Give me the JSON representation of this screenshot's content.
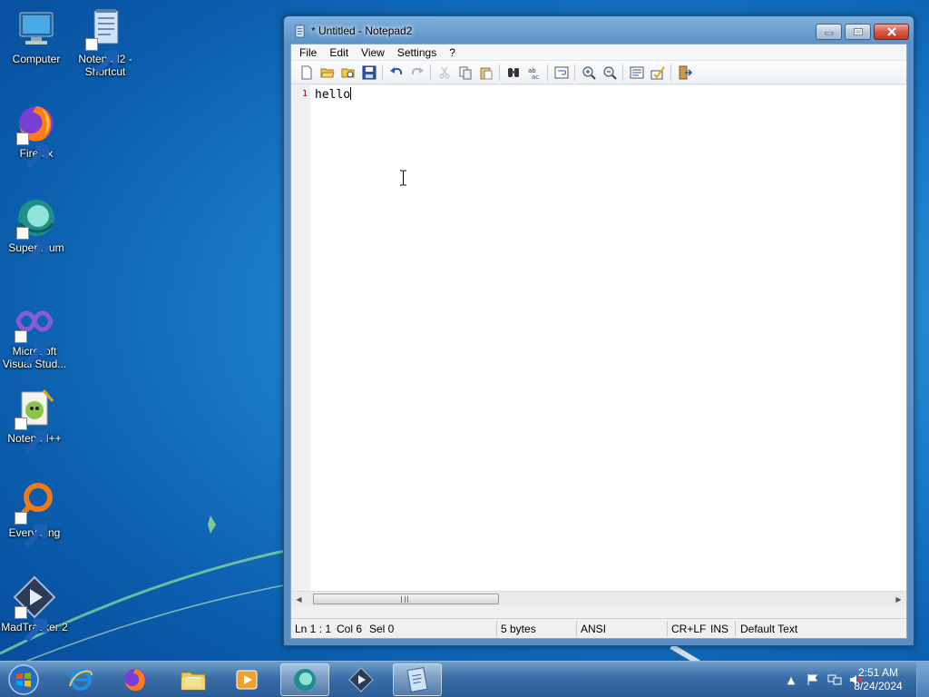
{
  "desktop": {
    "icons": [
      {
        "id": "computer",
        "label": "Computer"
      },
      {
        "id": "notepad2-shortcut",
        "label": "Notepad2 - Shortcut"
      },
      {
        "id": "firefox",
        "label": "Firefox"
      },
      {
        "id": "supermium",
        "label": "Supermium"
      },
      {
        "id": "visual-studio",
        "label": "Microsoft Visual Stud..."
      },
      {
        "id": "notepad-plus-plus",
        "label": "Notepad++"
      },
      {
        "id": "everything",
        "label": "Everything"
      },
      {
        "id": "madtracker",
        "label": "MadTracker 2"
      }
    ]
  },
  "window": {
    "title": "* Untitled - Notepad2",
    "menu": [
      "File",
      "Edit",
      "View",
      "Settings",
      "?"
    ],
    "toolbar_icons": [
      "new-icon",
      "open-icon",
      "browse-icon",
      "save-icon",
      "undo-icon",
      "redo-icon",
      "cut-icon",
      "copy-icon",
      "paste-icon",
      "find-icon",
      "replace-icon",
      "word-wrap-icon",
      "zoom-in-icon",
      "zoom-out-icon",
      "scheme-icon",
      "customize-icon",
      "exit-icon"
    ],
    "editor": {
      "line_number": "1",
      "text": "hello"
    },
    "status": {
      "position": "Ln 1 : 1",
      "column": "Col 6",
      "selection": "Sel 0",
      "size": "5 bytes",
      "encoding": "ANSI",
      "line_endings": "CR+LF",
      "mode": "INS",
      "scheme": "Default Text"
    }
  },
  "taskbar": {
    "pinned": [
      "start-orb",
      "internet-explorer",
      "firefox",
      "file-explorer",
      "media-player",
      "supermium",
      "madtracker",
      "notepad2"
    ],
    "clock": {
      "time": "2:51 AM",
      "date": "8/24/2024"
    }
  },
  "colors": {
    "desktop": "#1e82cc",
    "taskbar": "#3a6ea8",
    "line_number": "#aa0000"
  }
}
